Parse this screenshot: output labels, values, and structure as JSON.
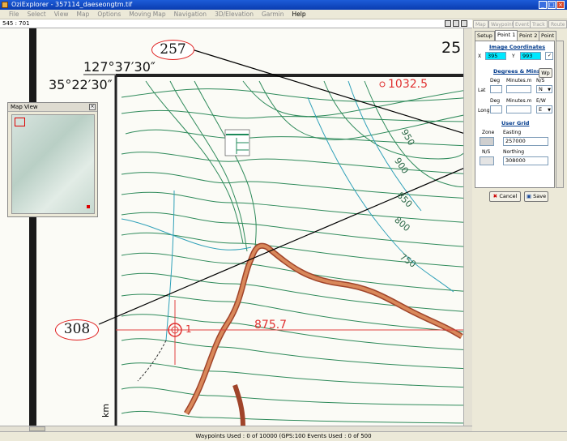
{
  "window": {
    "title": "OziExplorer - 357114_daeseongtm.tif"
  },
  "menu": [
    "File",
    "Select",
    "View",
    "Map",
    "Options",
    "Moving Map",
    "Navigation",
    "3D/Elevation",
    "Garmin",
    "Help"
  ],
  "coords_readout": "545 : 701",
  "map": {
    "longitude_label": "127°37′30″",
    "latitude_label": "35°22′30″",
    "callout_easting": "257",
    "callout_northing": "308",
    "corner_label": "25",
    "elevation_top": "1032.5",
    "elevation_mid": "875.7",
    "point_label": "1",
    "contour_labels": [
      "950",
      "900",
      "850",
      "800",
      "750"
    ],
    "scale_label": "km"
  },
  "map_view": {
    "title": "Map View"
  },
  "panel": {
    "top_tabs": [
      "Map",
      "Waypoint",
      "Event",
      "Track",
      "Route"
    ],
    "tabs": [
      "Setup",
      "Point 1",
      "Point 2",
      "Point"
    ],
    "image_coordinates": {
      "heading": "Image Coordinates",
      "x_label": "X",
      "x_value": "395",
      "y_label": "Y",
      "y_value": "993"
    },
    "degrees_mins": {
      "heading": "Degrees & Mins",
      "wp_button": "Wp",
      "lat_label": "Lat",
      "long_label": "Long",
      "deg_label": "Deg",
      "minutes_label": "Minutes.m",
      "ns_label": "N/S",
      "ew_label": "E/W",
      "ns_value": "N",
      "ew_value": "E"
    },
    "user_grid": {
      "heading": "User Grid",
      "zone_label": "Zone",
      "easting_label": "Easting",
      "easting_value": "257000",
      "ns_label": "N/S",
      "northing_label": "Northing",
      "northing_value": "308000"
    },
    "cancel_button": "Cancel",
    "save_button": "Save"
  },
  "status": {
    "text": "Waypoints Used : 0 of 10000  (GPS:100  Events Used : 0 of 500"
  },
  "colors": {
    "contour": "#2e8a5a",
    "road": "#c96a3a",
    "annotation": "#e03030",
    "grid": "#e04040",
    "blue_contour": "#2fa0b8"
  }
}
